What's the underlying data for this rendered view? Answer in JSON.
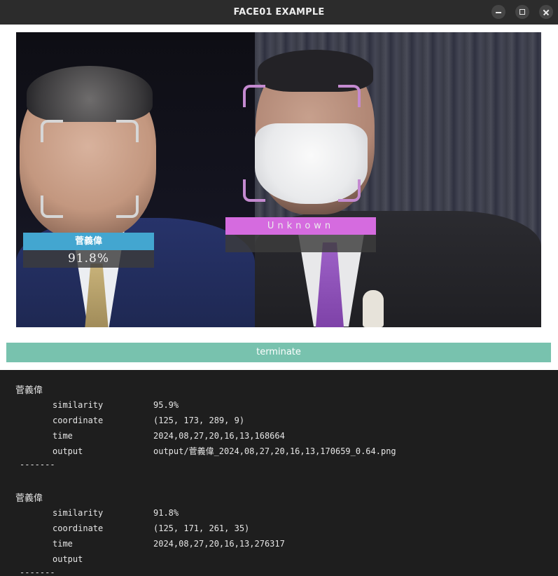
{
  "window": {
    "title": "FACE01 EXAMPLE"
  },
  "video": {
    "faces": [
      {
        "name": "菅義偉",
        "similarity": "91.8%",
        "box_color": "#d6d6d6",
        "label_color": "#43a6d0"
      },
      {
        "name": "Unknown",
        "similarity": "",
        "box_color": "#c48ad0",
        "label_color": "#d56bdf"
      }
    ]
  },
  "terminate_label": "terminate",
  "console": {
    "keys": {
      "similarity": "similarity",
      "coordinate": "coordinate",
      "time": "time",
      "output": "output"
    },
    "separator": "-------",
    "entries": [
      {
        "name": "菅義偉",
        "similarity": "95.9%",
        "coordinate": "(125, 173, 289, 9)",
        "time": "2024,08,27,20,16,13,168664",
        "output": "output/菅義偉_2024,08,27,20,16,13,170659_0.64.png"
      },
      {
        "name": "菅義偉",
        "similarity": "91.8%",
        "coordinate": "(125, 171, 261, 35)",
        "time": "2024,08,27,20,16,13,276317",
        "output": ""
      }
    ]
  }
}
